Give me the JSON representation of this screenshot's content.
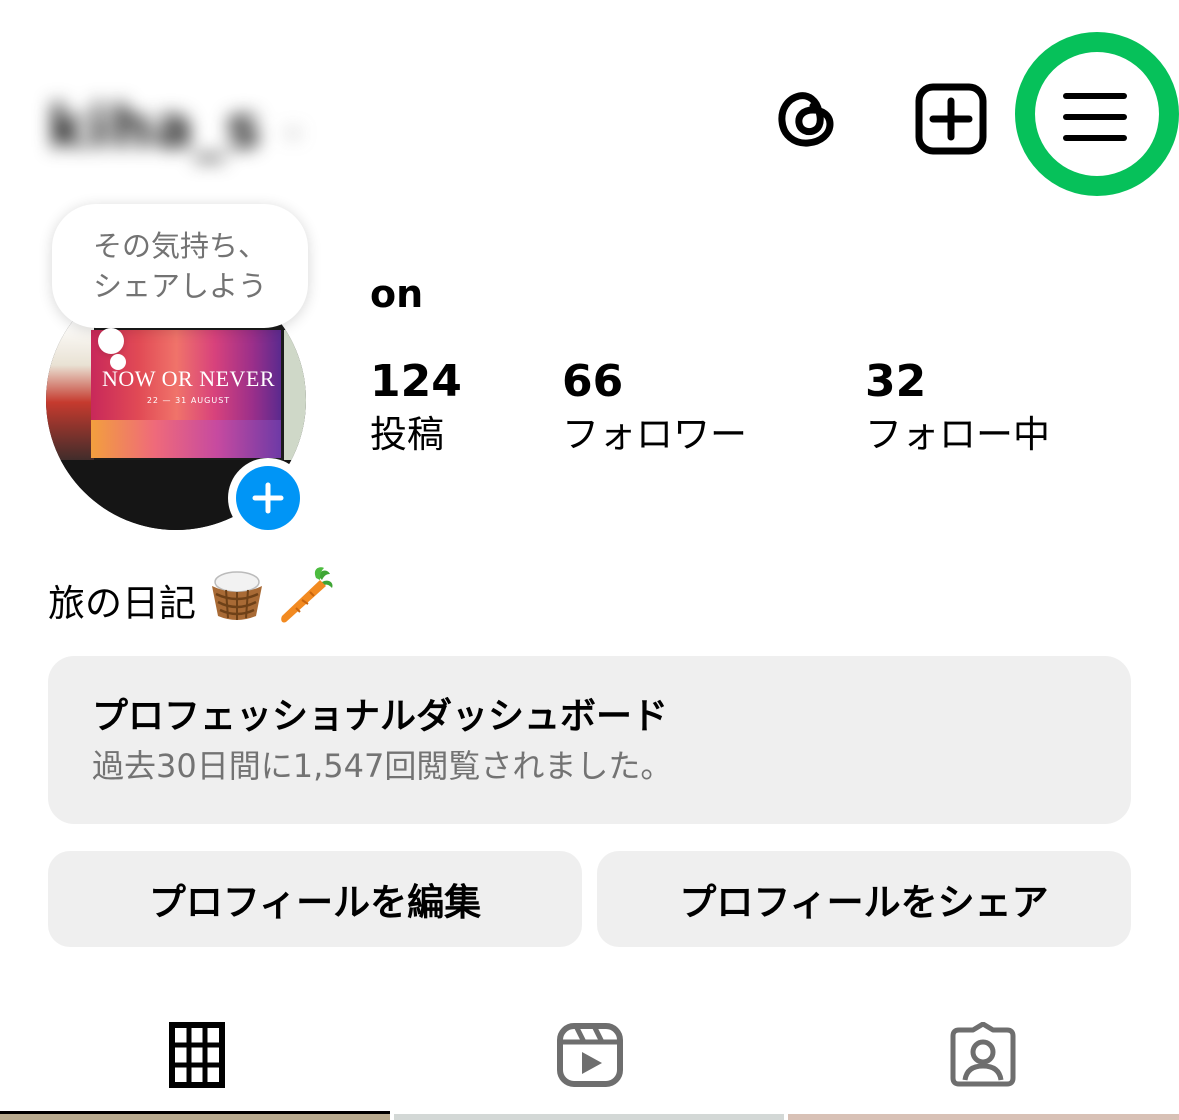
{
  "header": {
    "username": "kiha_s",
    "threads_icon": "threads-icon",
    "add_icon": "plus-square-icon",
    "menu_icon": "hamburger-menu-icon",
    "highlight_color": "#06c15a"
  },
  "note": {
    "text": "その気持ち、\nシェアしよう"
  },
  "avatar": {
    "poster_title": "NOW OR NEVER",
    "poster_sub": "22 — 31 AUGUST",
    "add_story_icon": "plus-circle-icon",
    "accent": "#0095f6"
  },
  "profile": {
    "display_name": "on",
    "stats": [
      {
        "value": "124",
        "label": "投稿"
      },
      {
        "value": "66",
        "label": "フォロワー"
      },
      {
        "value": "32",
        "label": "フォロー中"
      }
    ],
    "bio_text": "旅の日記",
    "bio_emojis": [
      "basket-emoji",
      "carrot-emoji"
    ]
  },
  "dashboard": {
    "title": "プロフェッショナルダッシュボード",
    "subtitle": "過去30日間に1,547回閲覧されました。"
  },
  "buttons": {
    "edit": "プロフィールを編集",
    "share": "プロフィールをシェア"
  },
  "tabs": [
    {
      "icon": "grid-icon",
      "active": true
    },
    {
      "icon": "reels-icon",
      "active": false
    },
    {
      "icon": "tagged-person-icon",
      "active": false
    }
  ]
}
